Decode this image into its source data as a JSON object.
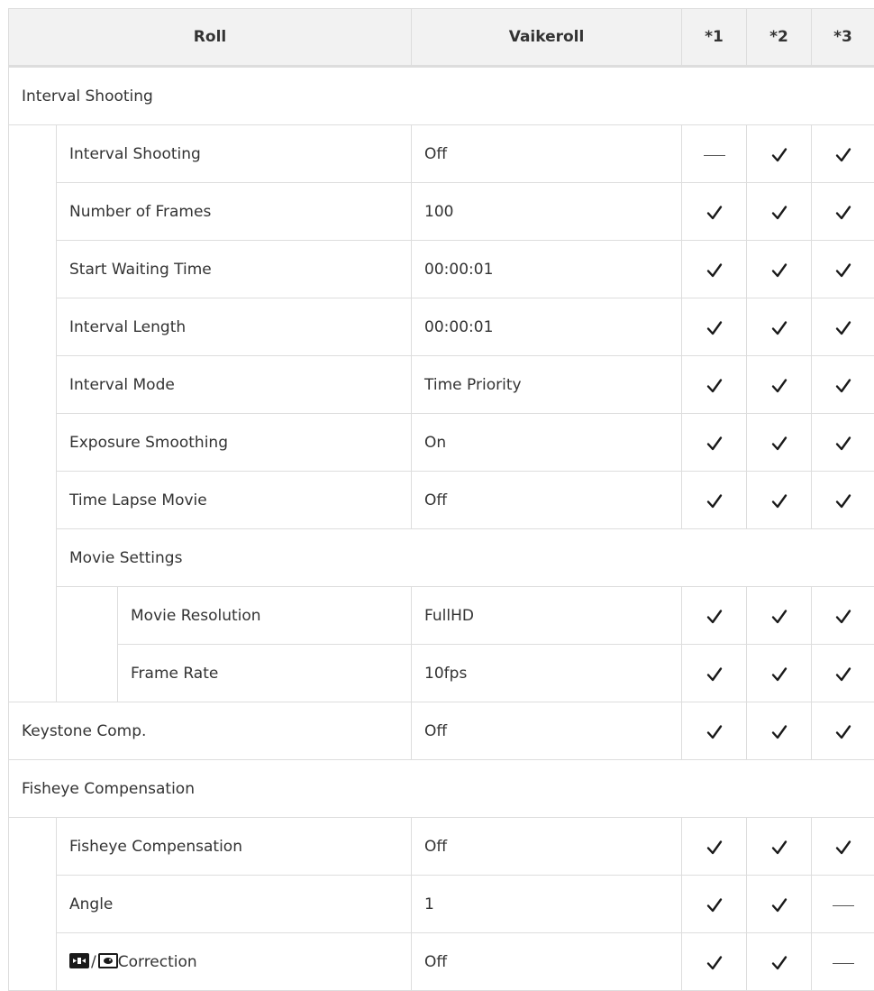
{
  "table": {
    "headers": {
      "roll": "Roll",
      "default": "Vaikeroll",
      "c1": "*1",
      "c2": "*2",
      "c3": "*3"
    },
    "section_interval": "Interval Shooting",
    "rows_interval": [
      {
        "label": "Interval Shooting",
        "value": "Off",
        "marks": [
          "dash",
          "check",
          "check"
        ]
      },
      {
        "label": "Number of Frames",
        "value": "100",
        "marks": [
          "check",
          "check",
          "check"
        ]
      },
      {
        "label": "Start Waiting Time",
        "value": "00:00:01",
        "marks": [
          "check",
          "check",
          "check"
        ]
      },
      {
        "label": "Interval Length",
        "value": "00:00:01",
        "marks": [
          "check",
          "check",
          "check"
        ]
      },
      {
        "label": "Interval Mode",
        "value": "Time Priority",
        "marks": [
          "check",
          "check",
          "check"
        ]
      },
      {
        "label": "Exposure Smoothing",
        "value": "On",
        "marks": [
          "check",
          "check",
          "check"
        ]
      },
      {
        "label": "Time Lapse Movie",
        "value": "Off",
        "marks": [
          "check",
          "check",
          "check"
        ]
      }
    ],
    "subsection_movie": "Movie Settings",
    "rows_movie": [
      {
        "label": "Movie Resolution",
        "value": "FullHD",
        "marks": [
          "check",
          "check",
          "check"
        ]
      },
      {
        "label": "Frame Rate",
        "value": "10fps",
        "marks": [
          "check",
          "check",
          "check"
        ]
      }
    ],
    "row_keystone": {
      "label": "Keystone Comp.",
      "value": "Off",
      "marks": [
        "check",
        "check",
        "check"
      ]
    },
    "section_fisheye": "Fisheye Compensation",
    "rows_fisheye": [
      {
        "label": "Fisheye Compensation",
        "value": "Off",
        "marks": [
          "check",
          "check",
          "check"
        ]
      },
      {
        "label": "Angle",
        "value": "1",
        "marks": [
          "check",
          "check",
          "dash"
        ]
      },
      {
        "label": "Correction",
        "value": "Off",
        "marks": [
          "check",
          "check",
          "dash"
        ],
        "icons": [
          "wide-angle-icon",
          "fisheye-icon"
        ],
        "separator": "/"
      }
    ]
  }
}
